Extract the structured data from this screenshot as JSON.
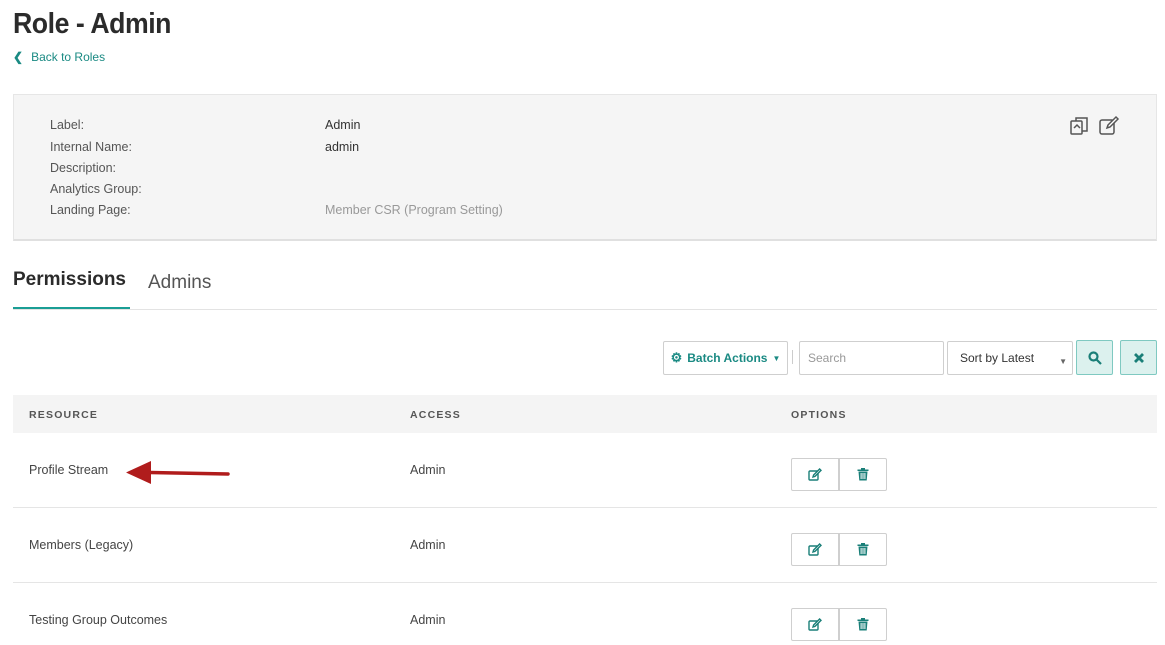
{
  "header": {
    "title": "Role - Admin",
    "back_link": "Back to Roles"
  },
  "details": {
    "fields": [
      {
        "label": "Label:",
        "value": "Admin"
      },
      {
        "label": "Internal Name:",
        "value": "admin"
      },
      {
        "label": "Description:",
        "value": ""
      },
      {
        "label": "Analytics Group:",
        "value": ""
      },
      {
        "label": "Landing Page:",
        "value": "Member CSR (Program Setting)"
      }
    ],
    "icons": [
      "copy-icon",
      "edit-icon"
    ]
  },
  "tabs": [
    {
      "label": "Permissions",
      "active": true
    },
    {
      "label": "Admins",
      "active": false
    }
  ],
  "toolbar": {
    "batch_label": "Batch Actions",
    "search_placeholder": "Search",
    "sort_value": "Sort by Latest"
  },
  "table": {
    "columns": [
      "RESOURCE",
      "ACCESS",
      "OPTIONS"
    ],
    "rows": [
      {
        "resource": "Profile Stream",
        "access": "Admin"
      },
      {
        "resource": "Members (Legacy)",
        "access": "Admin"
      },
      {
        "resource": "Testing Group Outcomes",
        "access": "Admin"
      }
    ]
  },
  "colors": {
    "accent": "#1a9e95",
    "annotation_arrow": "#b01c1c"
  }
}
